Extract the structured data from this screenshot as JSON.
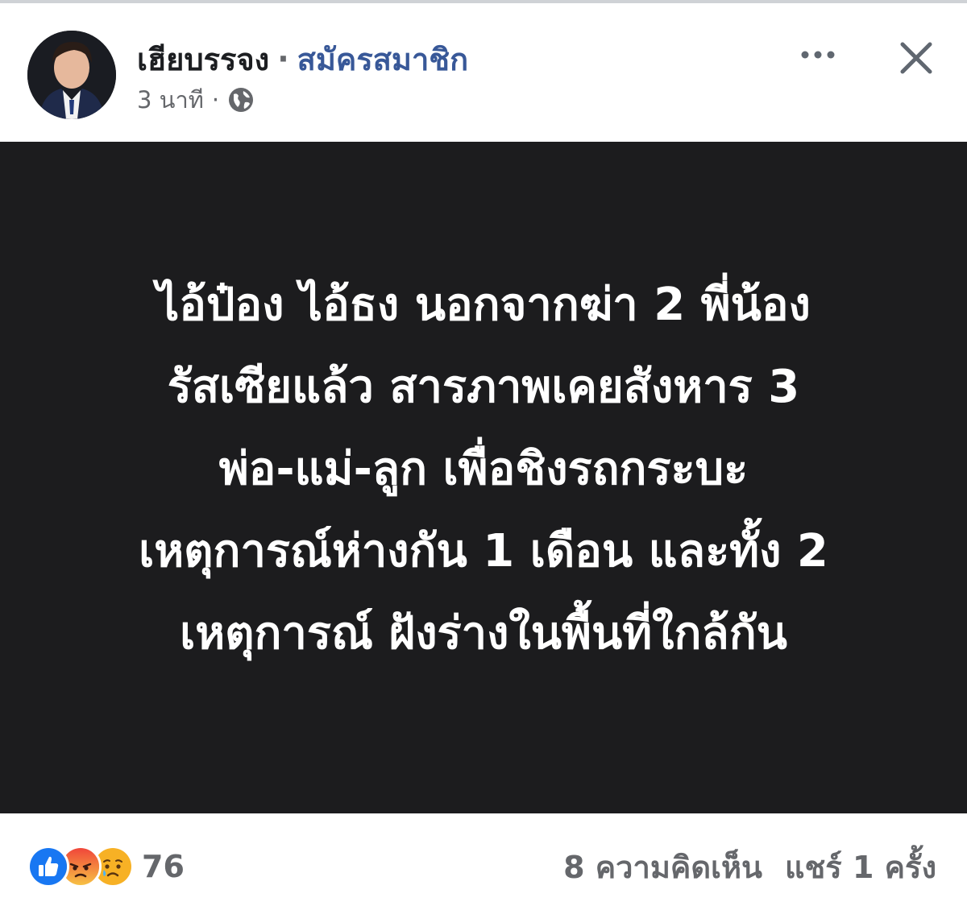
{
  "post": {
    "author_name": "เฮียบรรจง",
    "separator": "·",
    "subscribe_label": "สมัครสมาชิก",
    "timestamp": "3 นาที",
    "meta_separator": "·",
    "privacy_icon": "globe-icon",
    "lines": [
      "ไอ้ป๋อง ไอ้ธง นอกจากฆ่า 2 พี่น้อง",
      "รัสเซียแล้ว สารภาพเคยสังหาร 3",
      "พ่อ-แม่-ลูก เพื่อชิงรถกระบะ",
      "เหตุการณ์ห่างกัน 1 เดือน และทั้ง 2",
      "เหตุการณ์ ฝังร่างในพื้นที่ใกล้กัน"
    ]
  },
  "header": {
    "more_icon": "more-icon",
    "close_icon": "close-icon"
  },
  "footer": {
    "reaction_icons": [
      "like-icon",
      "angry-icon",
      "sad-icon"
    ],
    "reaction_count": "76",
    "comments": "8 ความคิดเห็น",
    "shares": "แชร์ 1 ครั้ง"
  },
  "colors": {
    "link": "#385898",
    "post_background": "#1c1c1e",
    "secondary_text": "#65676b",
    "like_blue": "#1877f2",
    "angry_red": "#e9573f",
    "sad_yellow": "#f7b125"
  }
}
